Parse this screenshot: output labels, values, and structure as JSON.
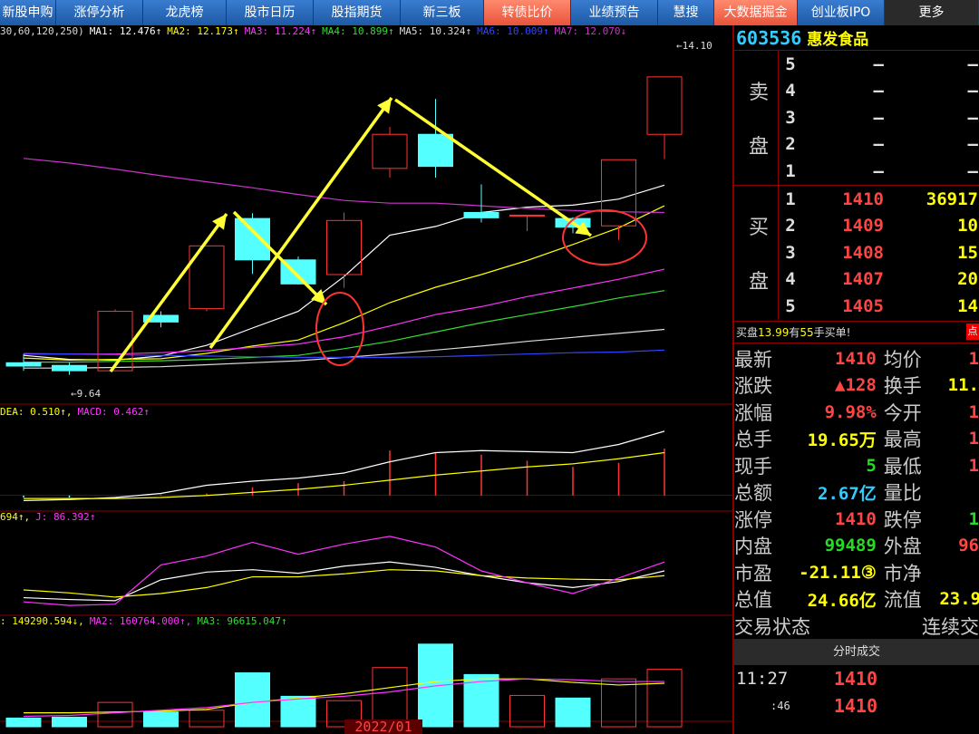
{
  "nav": {
    "tabs": [
      {
        "label": "新股申购",
        "w": 62,
        "style": "normal"
      },
      {
        "label": "涨停分析",
        "w": 96,
        "style": "normal"
      },
      {
        "label": "龙虎榜",
        "w": 92,
        "style": "normal"
      },
      {
        "label": "股市日历",
        "w": 96,
        "style": "normal"
      },
      {
        "label": "股指期货",
        "w": 96,
        "style": "normal"
      },
      {
        "label": "新三板",
        "w": 92,
        "style": "normal"
      },
      {
        "label": "转债比价",
        "w": 96,
        "style": "hl"
      },
      {
        "label": "业绩预告",
        "w": 96,
        "style": "normal"
      },
      {
        "label": "慧搜",
        "w": 62,
        "style": "normal"
      },
      {
        "label": "大数据掘金",
        "w": 92,
        "style": "hl"
      },
      {
        "label": "创业板IPO",
        "w": 96,
        "style": "normal"
      },
      {
        "label": "更多",
        "w": 104,
        "style": "dark"
      }
    ]
  },
  "legends": {
    "price": [
      {
        "text": "30,60,120,250)",
        "color": "#dddddd"
      },
      {
        "text": "MA1: 12.476↑",
        "color": "#ffffff"
      },
      {
        "text": "MA2: 12.173↑",
        "color": "#ffff00"
      },
      {
        "text": "MA3: 11.224↑",
        "color": "#ff33ff"
      },
      {
        "text": "MA4: 10.899↑",
        "color": "#33dd33"
      },
      {
        "text": "MA5: 10.324↑",
        "color": "#dddddd"
      },
      {
        "text": "MA6: 10.009↑",
        "color": "#3344ff"
      },
      {
        "text": "MA7: 12.070↓",
        "color": "#cc33cc"
      }
    ],
    "macd": [
      {
        "text": "DEA: 0.510↑,",
        "color": "#ffff00"
      },
      {
        "text": "MACD: 0.462↑",
        "color": "#ff33ff"
      }
    ],
    "kdj": [
      {
        "text": "694↑,",
        "color": "#ffff00"
      },
      {
        "text": "J: 86.392↑",
        "color": "#ff33ff"
      }
    ],
    "vol": [
      {
        "text": ": 149290.594↓,",
        "color": "#ffff00"
      },
      {
        "text": "MA2: 160764.000↑,",
        "color": "#ff33ff"
      },
      {
        "text": "MA3: 96615.047↑",
        "color": "#33dd33"
      }
    ]
  },
  "chart_labels": {
    "high_label": "14.10",
    "low_label": "9.64",
    "date": "2022/01"
  },
  "stock": {
    "code": "603536",
    "name": "惠发食品"
  },
  "order_book": {
    "sell_label": [
      "卖",
      "盘"
    ],
    "buy_label": [
      "买",
      "盘"
    ],
    "sell": [
      {
        "lvl": "5",
        "px": "—",
        "vol": "—"
      },
      {
        "lvl": "4",
        "px": "—",
        "vol": "—"
      },
      {
        "lvl": "3",
        "px": "—",
        "vol": "—"
      },
      {
        "lvl": "2",
        "px": "—",
        "vol": "—"
      },
      {
        "lvl": "1",
        "px": "—",
        "vol": "—"
      }
    ],
    "buy": [
      {
        "lvl": "1",
        "px": "1410",
        "vol": "36917"
      },
      {
        "lvl": "2",
        "px": "1409",
        "vol": "10"
      },
      {
        "lvl": "3",
        "px": "1408",
        "vol": "15"
      },
      {
        "lvl": "4",
        "px": "1407",
        "vol": "20"
      },
      {
        "lvl": "5",
        "px": "1405",
        "vol": "14"
      }
    ]
  },
  "buy_info": {
    "prefix": "买盘",
    "price": "13.99",
    "mid": "有",
    "count": "55",
    "suffix": "手买单!",
    "corner": "点"
  },
  "quote": [
    {
      "l1": "最新",
      "v1": "1410",
      "c1": "red",
      "l2": "均价",
      "v2": "1",
      "c2": "red"
    },
    {
      "l1": "涨跌",
      "v1": "▲128",
      "c1": "red",
      "l2": "换手",
      "v2": "11.",
      "c2": "yellow"
    },
    {
      "l1": "涨幅",
      "v1": "9.98%",
      "c1": "red",
      "l2": "今开",
      "v2": "1",
      "c2": "red"
    },
    {
      "l1": "总手",
      "v1": "19.65万",
      "c1": "yellow",
      "l2": "最高",
      "v2": "1",
      "c2": "red"
    },
    {
      "l1": "现手",
      "v1": "5",
      "c1": "green",
      "l2": "最低",
      "v2": "1",
      "c2": "red"
    },
    {
      "l1": "总额",
      "v1": "2.67亿",
      "c1": "cyan",
      "l2": "量比",
      "v2": "",
      "c2": "yellow"
    },
    {
      "l1": "涨停",
      "v1": "1410",
      "c1": "red",
      "l2": "跌停",
      "v2": "1",
      "c2": "green"
    },
    {
      "l1": "内盘",
      "v1": "99489",
      "c1": "green",
      "l2": "外盘",
      "v2": "96",
      "c2": "red"
    },
    {
      "l1": "市盈",
      "v1": "-21.11③",
      "c1": "yellow",
      "l2": "市净",
      "v2": "",
      "c2": "yellow"
    },
    {
      "l1": "总值",
      "v1": "24.66亿",
      "c1": "yellow",
      "l2": "流值",
      "v2": "23.9",
      "c2": "yellow"
    }
  ],
  "trade_state": {
    "label": "交易状态",
    "value": "连续交"
  },
  "ticks": {
    "header": "分时成交",
    "rows": [
      {
        "time": "11:27",
        "price": "1410",
        "small": false
      },
      {
        "time": ":46",
        "price": "1410",
        "small": true
      }
    ]
  },
  "chart_data": {
    "type": "candlestick",
    "candles": [
      {
        "o": 9.82,
        "h": 9.95,
        "l": 9.7,
        "c": 9.77,
        "up": false
      },
      {
        "o": 9.78,
        "h": 9.82,
        "l": 9.64,
        "c": 9.7,
        "up": false
      },
      {
        "o": 9.7,
        "h": 10.62,
        "l": 9.7,
        "c": 10.59,
        "up": true
      },
      {
        "o": 10.43,
        "h": 10.59,
        "l": 10.35,
        "c": 10.53,
        "up": false
      },
      {
        "o": 10.63,
        "h": 11.57,
        "l": 10.59,
        "c": 11.57,
        "up": true
      },
      {
        "o": 11.98,
        "h": 12.06,
        "l": 11.15,
        "c": 11.36,
        "up": false
      },
      {
        "o": 11.36,
        "h": 11.41,
        "l": 10.99,
        "c": 11.0,
        "up": false
      },
      {
        "o": 11.14,
        "h": 12.07,
        "l": 10.94,
        "c": 11.95,
        "up": true
      },
      {
        "o": 12.73,
        "h": 13.35,
        "l": 12.59,
        "c": 13.24,
        "up": true
      },
      {
        "o": 13.24,
        "h": 13.77,
        "l": 12.59,
        "c": 12.76,
        "up": false
      },
      {
        "o": 12.07,
        "h": 12.49,
        "l": 11.92,
        "c": 11.99,
        "up": false
      },
      {
        "o": 12.03,
        "h": 12.03,
        "l": 11.79,
        "c": 12.03,
        "up": true
      },
      {
        "o": 11.98,
        "h": 12.0,
        "l": 11.76,
        "c": 11.85,
        "up": false
      },
      {
        "o": 11.87,
        "h": 12.86,
        "l": 11.66,
        "c": 12.86,
        "up": true
      },
      {
        "o": 13.24,
        "h": 14.1,
        "l": 12.87,
        "c": 14.1,
        "up": true
      }
    ],
    "ma_lines": [
      {
        "name": "MA1",
        "color": "#ffffff",
        "values": [
          9.93,
          9.87,
          9.86,
          9.92,
          10.08,
          10.34,
          10.59,
          11.11,
          11.73,
          11.86,
          12.07,
          12.15,
          12.18,
          12.27,
          12.48
        ]
      },
      {
        "name": "MA2",
        "color": "#ffff00",
        "values": [
          9.89,
          9.86,
          9.87,
          9.88,
          9.96,
          10.07,
          10.16,
          10.42,
          10.72,
          10.95,
          11.14,
          11.35,
          11.59,
          11.84,
          12.17
        ]
      },
      {
        "name": "MA3",
        "color": "#ff33ff",
        "values": [
          9.95,
          9.95,
          9.95,
          9.97,
          10.0,
          10.05,
          10.1,
          10.21,
          10.37,
          10.54,
          10.66,
          10.81,
          10.94,
          11.07,
          11.22
        ]
      },
      {
        "name": "MA4",
        "color": "#33dd33",
        "values": [
          9.83,
          9.83,
          9.84,
          9.85,
          9.87,
          9.9,
          9.93,
          10.03,
          10.14,
          10.28,
          10.42,
          10.54,
          10.66,
          10.79,
          10.9
        ]
      },
      {
        "name": "MA5",
        "color": "#dddddd",
        "values": [
          9.74,
          9.74,
          9.75,
          9.76,
          9.79,
          9.82,
          9.85,
          9.9,
          9.95,
          10.01,
          10.07,
          10.14,
          10.2,
          10.26,
          10.32
        ]
      },
      {
        "name": "MA6",
        "color": "#3344ff",
        "values": [
          9.96,
          9.95,
          9.94,
          9.93,
          9.92,
          9.91,
          9.9,
          9.9,
          9.9,
          9.91,
          9.93,
          9.95,
          9.97,
          9.98,
          10.01
        ]
      },
      {
        "name": "MA7",
        "color": "#cc33cc",
        "values": [
          12.88,
          12.81,
          12.72,
          12.62,
          12.53,
          12.44,
          12.34,
          12.25,
          12.21,
          12.21,
          12.17,
          12.13,
          12.1,
          12.08,
          12.07
        ]
      }
    ],
    "price_range": [
      9.2,
      14.6
    ],
    "macd": {
      "dif": [
        -0.05,
        -0.04,
        -0.02,
        0.02,
        0.1,
        0.14,
        0.17,
        0.22,
        0.33,
        0.42,
        0.44,
        0.43,
        0.42,
        0.5,
        0.63
      ],
      "dea": [
        -0.03,
        -0.03,
        -0.03,
        -0.02,
        0.0,
        0.03,
        0.06,
        0.1,
        0.15,
        0.2,
        0.24,
        0.28,
        0.31,
        0.36,
        0.42
      ],
      "bar": [
        -0.02,
        -0.02,
        0.0,
        0.01,
        0.02,
        0.08,
        0.12,
        0.14,
        0.44,
        0.42,
        0.4,
        0.34,
        0.28,
        0.32,
        0.46
      ],
      "range": [
        -0.1,
        0.7
      ]
    },
    "kdj": {
      "k": [
        25,
        22,
        20,
        55,
        68,
        72,
        66,
        78,
        85,
        76,
        62,
        50,
        42,
        52,
        70
      ],
      "d": [
        38,
        33,
        26,
        32,
        42,
        60,
        60,
        65,
        72,
        70,
        62,
        58,
        56,
        55,
        62
      ],
      "j": [
        18,
        12,
        14,
        80,
        95,
        118,
        98,
        115,
        128,
        110,
        70,
        50,
        32,
        58,
        85
      ],
      "range": [
        0,
        140
      ]
    },
    "volume": {
      "values": [
        10,
        11,
        28,
        17,
        19,
        62,
        35,
        30,
        68,
        95,
        60,
        36,
        33,
        55,
        66
      ],
      "ma": [
        16,
        16,
        17,
        18,
        20,
        28,
        33,
        38,
        45,
        52,
        55,
        55,
        51,
        48,
        50
      ],
      "ma2": [
        12,
        13,
        16,
        19,
        22,
        28,
        32,
        35,
        40,
        47,
        52,
        55,
        54,
        52,
        52
      ],
      "range": [
        0,
        100
      ]
    }
  }
}
